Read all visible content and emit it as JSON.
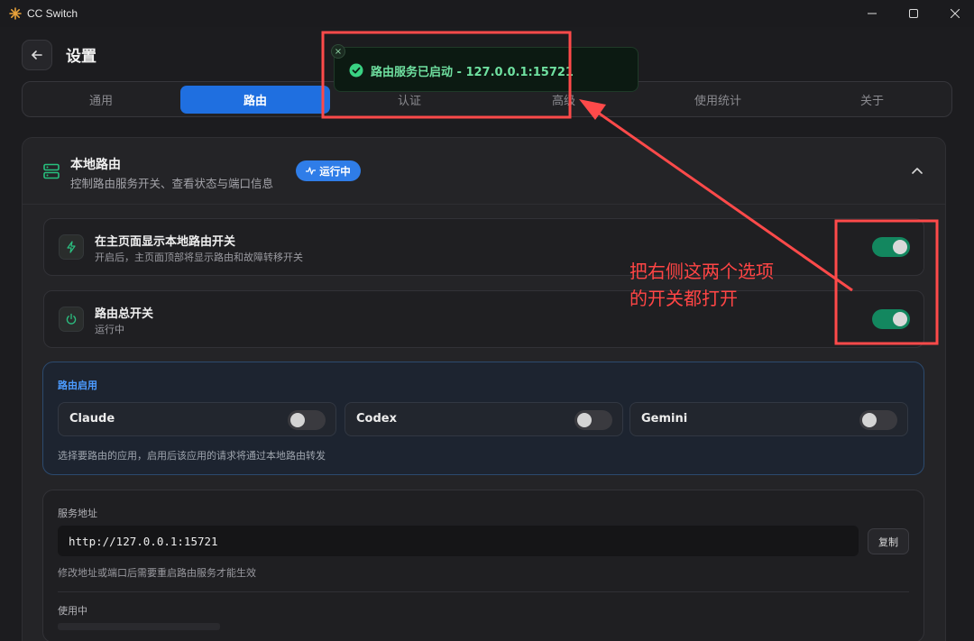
{
  "window": {
    "title": "CC Switch",
    "icons": [
      "app-logo-icon",
      "minimize-icon",
      "maximize-icon",
      "close-icon"
    ]
  },
  "header": {
    "title": "设置",
    "back_icon": "arrow-left-icon"
  },
  "tabs": [
    {
      "label": "通用",
      "active": false
    },
    {
      "label": "路由",
      "active": true
    },
    {
      "label": "认证",
      "active": false
    },
    {
      "label": "高级",
      "active": false
    },
    {
      "label": "使用统计",
      "active": false
    },
    {
      "label": "关于",
      "active": false
    }
  ],
  "router": {
    "title": "本地路由",
    "subtitle": "控制路由服务开关、查看状态与端口信息",
    "badge": "运行中",
    "rows": [
      {
        "title": "在主页面显示本地路由开关",
        "desc": "开启后，主页面顶部将显示路由和故障转移开关",
        "enabled": true,
        "icon": "lightning-icon"
      },
      {
        "title": "路由总开关",
        "desc": "运行中",
        "enabled": true,
        "icon": "power-icon"
      }
    ],
    "apps": {
      "title": "路由启用",
      "items": [
        {
          "label": "Claude",
          "enabled": false
        },
        {
          "label": "Codex",
          "enabled": false
        },
        {
          "label": "Gemini",
          "enabled": false
        }
      ],
      "note": "选择要路由的应用，启用后该应用的请求将通过本地路由转发"
    },
    "service": {
      "label": "服务地址",
      "address": "http://127.0.0.1:15721",
      "copy_label": "复制",
      "note": "修改地址或端口后需要重启路由服务才能生效",
      "in_use_label": "使用中"
    }
  },
  "toast": {
    "message": "路由服务已启动 - 127.0.0.1:15721",
    "close": "×"
  },
  "annotation": {
    "line1": "把右侧这两个选项",
    "line2": "的开关都打开",
    "color": "#ff4545"
  },
  "colors": {
    "accent": "#1f6fe0",
    "toggle_on": "#13875f",
    "badge": "#2f7de8",
    "toast_text": "#6fe0a0"
  }
}
